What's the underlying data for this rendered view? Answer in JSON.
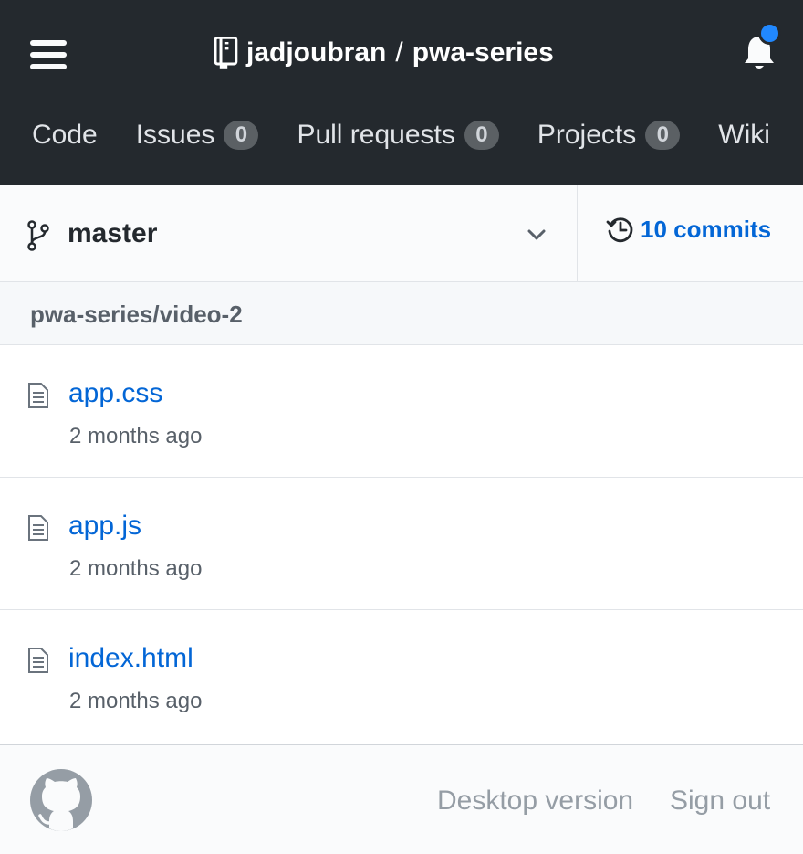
{
  "header": {
    "owner": "jadjoubran",
    "separator": "/",
    "repo": "pwa-series",
    "menu_icon": "hamburger-menu-icon",
    "repo_icon": "repo-book-icon",
    "bell_icon": "notification-bell-icon",
    "notification_dot_color": "#2188ff",
    "background_color": "#24292e"
  },
  "reponav": {
    "items": [
      {
        "label": "Code"
      },
      {
        "label": "Issues",
        "count": "0"
      },
      {
        "label": "Pull requests",
        "count": "0"
      },
      {
        "label": "Projects",
        "count": "0"
      },
      {
        "label": "Wiki"
      }
    ]
  },
  "branch": {
    "name": "master",
    "branch_icon": "git-branch-icon",
    "dropdown_icon": "chevron-down-icon",
    "commits_label": "10 commits",
    "history_icon": "history-icon"
  },
  "path": {
    "text": "pwa-series/video-2"
  },
  "files": [
    {
      "name": "app.css",
      "age": "2 months ago"
    },
    {
      "name": "app.js",
      "age": "2 months ago"
    },
    {
      "name": "index.html",
      "age": "2 months ago"
    }
  ],
  "footer": {
    "logo_icon": "github-octocat-icon",
    "desktop_version": "Desktop version",
    "sign_out": "Sign out"
  },
  "colors": {
    "link": "#0366d6",
    "muted": "#586069",
    "footer_link": "#959da5"
  }
}
